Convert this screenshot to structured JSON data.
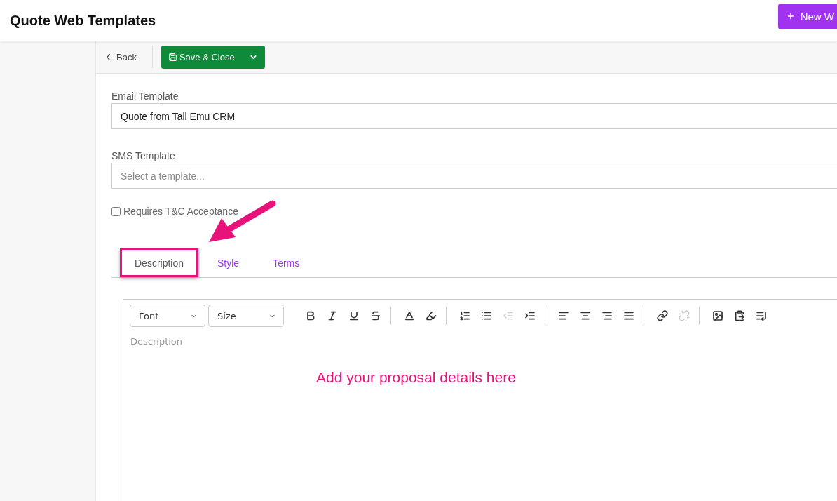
{
  "header": {
    "title": "Quote Web Templates",
    "new_button": "New W"
  },
  "toolbar": {
    "back": "Back",
    "save": "Save & Close"
  },
  "form": {
    "email_label": "Email Template",
    "email_value": "Quote from Tall Emu CRM",
    "sms_label": "SMS Template",
    "sms_placeholder": "Select a template...",
    "tc": {
      "label": "Requires T&C Acceptance",
      "checked": false
    }
  },
  "tabs": [
    {
      "label": "Description",
      "selected": true,
      "highlighted": true
    },
    {
      "label": "Style",
      "selected": false,
      "highlighted": false
    },
    {
      "label": "Terms",
      "selected": false,
      "highlighted": false
    }
  ],
  "editor": {
    "font": "Font",
    "size": "Size",
    "placeholder": "Description",
    "groups": [
      [
        {
          "kind": "bold",
          "disabled": false
        },
        {
          "kind": "italic",
          "disabled": false
        },
        {
          "kind": "underline",
          "disabled": false
        },
        {
          "kind": "strike",
          "disabled": false
        }
      ],
      [
        {
          "kind": "font-color",
          "disabled": false
        },
        {
          "kind": "back-color",
          "disabled": false
        }
      ],
      [
        {
          "kind": "ordered-list",
          "disabled": false
        },
        {
          "kind": "bullet-list",
          "disabled": false
        },
        {
          "kind": "outdent",
          "disabled": true
        },
        {
          "kind": "indent",
          "disabled": false
        }
      ],
      [
        {
          "kind": "align-left",
          "disabled": false
        },
        {
          "kind": "align-center",
          "disabled": false
        },
        {
          "kind": "align-right",
          "disabled": false
        },
        {
          "kind": "justify",
          "disabled": false
        }
      ],
      [
        {
          "kind": "link",
          "disabled": false
        },
        {
          "kind": "unlink",
          "disabled": true
        }
      ],
      [
        {
          "kind": "image",
          "disabled": false
        },
        {
          "kind": "paste",
          "disabled": false
        },
        {
          "kind": "insert-line",
          "disabled": false
        }
      ]
    ]
  },
  "annotation": {
    "text": "Add your proposal details here"
  }
}
